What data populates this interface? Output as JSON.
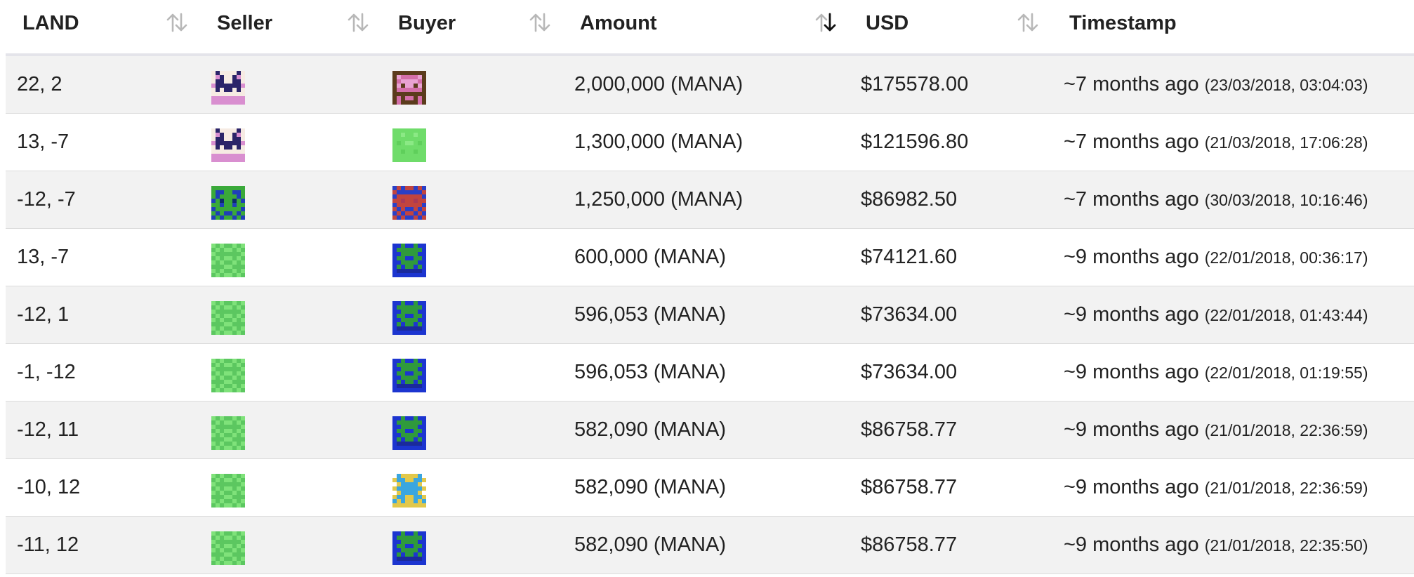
{
  "columns": {
    "land": "LAND",
    "seller": "Seller",
    "buyer": "Buyer",
    "amount": "Amount",
    "usd": "USD",
    "timestamp": "Timestamp"
  },
  "sort": {
    "column": "Amount",
    "direction": "descending"
  },
  "rows": [
    {
      "land": "22, 2",
      "seller_icon": "avatar-pink-invader",
      "buyer_icon": "avatar-brown-pink",
      "amount": "2,000,000 (MANA)",
      "usd": "$175578.00",
      "ago": "~7 months ago",
      "date": "(23/03/2018, 03:04:03)"
    },
    {
      "land": "13, -7",
      "seller_icon": "avatar-pink-invader",
      "buyer_icon": "avatar-green-plain",
      "amount": "1,300,000 (MANA)",
      "usd": "$121596.80",
      "ago": "~7 months ago",
      "date": "(21/03/2018, 17:06:28)"
    },
    {
      "land": "-12, -7",
      "seller_icon": "avatar-blue-green",
      "buyer_icon": "avatar-blue-red",
      "amount": "1,250,000 (MANA)",
      "usd": "$86982.50",
      "ago": "~7 months ago",
      "date": "(30/03/2018, 10:16:46)"
    },
    {
      "land": "13, -7",
      "seller_icon": "avatar-green-checker",
      "buyer_icon": "avatar-blue-creature",
      "amount": "600,000 (MANA)",
      "usd": "$74121.60",
      "ago": "~9 months ago",
      "date": "(22/01/2018, 00:36:17)"
    },
    {
      "land": "-12, 1",
      "seller_icon": "avatar-green-checker",
      "buyer_icon": "avatar-blue-creature",
      "amount": "596,053 (MANA)",
      "usd": "$73634.00",
      "ago": "~9 months ago",
      "date": "(22/01/2018, 01:43:44)"
    },
    {
      "land": "-1, -12",
      "seller_icon": "avatar-green-checker",
      "buyer_icon": "avatar-blue-creature",
      "amount": "596,053 (MANA)",
      "usd": "$73634.00",
      "ago": "~9 months ago",
      "date": "(22/01/2018, 01:19:55)"
    },
    {
      "land": "-12, 11",
      "seller_icon": "avatar-green-checker",
      "buyer_icon": "avatar-blue-creature",
      "amount": "582,090 (MANA)",
      "usd": "$86758.77",
      "ago": "~9 months ago",
      "date": "(21/01/2018, 22:36:59)"
    },
    {
      "land": "-10, 12",
      "seller_icon": "avatar-green-checker",
      "buyer_icon": "avatar-yellow-cyan",
      "amount": "582,090 (MANA)",
      "usd": "$86758.77",
      "ago": "~9 months ago",
      "date": "(21/01/2018, 22:36:59)"
    },
    {
      "land": "-11, 12",
      "seller_icon": "avatar-green-checker",
      "buyer_icon": "avatar-blue-creature",
      "amount": "582,090 (MANA)",
      "usd": "$86758.77",
      "ago": "~9 months ago",
      "date": "(21/01/2018, 22:35:50)"
    }
  ]
}
